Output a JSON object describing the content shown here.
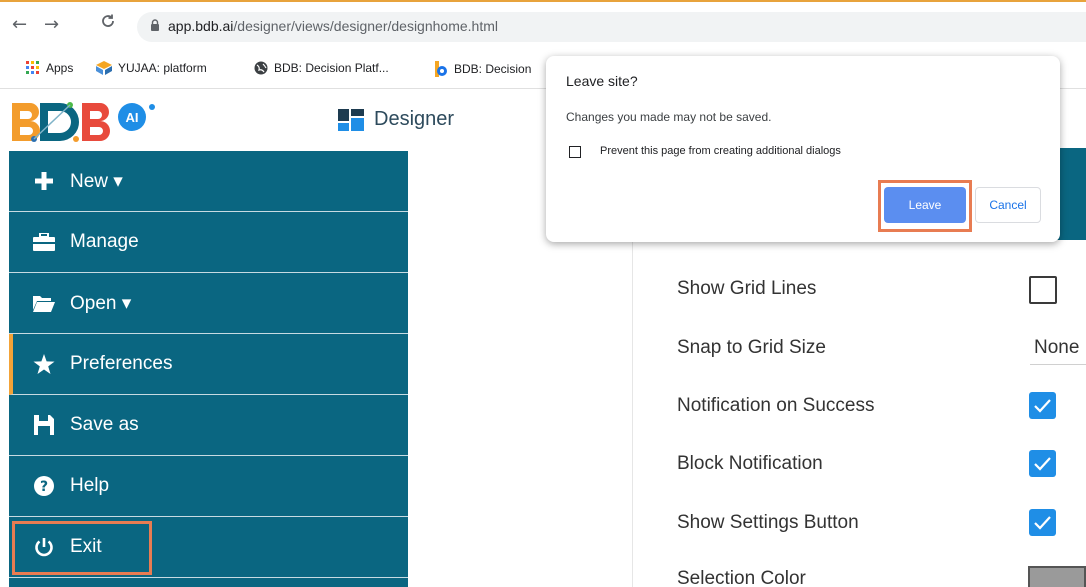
{
  "browser": {
    "back_icon": "arrow-left",
    "forward_icon": "arrow-right",
    "reload_icon": "reload",
    "url_host": "app.bdb.ai",
    "url_path": "/designer/views/designer/designhome.html",
    "bookmarks": [
      {
        "label": "Apps",
        "icon": "apps-grid"
      },
      {
        "label": "YUJAA: platform",
        "icon": "yujaa-logo"
      },
      {
        "label": "BDB: Decision Platf...",
        "icon": "globe"
      },
      {
        "label": "BDB: Decision",
        "icon": "bdb-logo"
      }
    ]
  },
  "app": {
    "title": "Designer",
    "logo_alt": "AI",
    "accent_color": "#0a6681",
    "active_color": "#f3a338"
  },
  "sidebar": {
    "items": [
      {
        "label": "New ▾",
        "icon": "plus"
      },
      {
        "label": "Manage",
        "icon": "briefcase"
      },
      {
        "label": "Open ▾",
        "icon": "folder-open"
      },
      {
        "label": "Preferences",
        "icon": "star",
        "active": true
      },
      {
        "label": "Save as",
        "icon": "save"
      },
      {
        "label": "Help",
        "icon": "question-circle"
      },
      {
        "label": "Exit",
        "icon": "power"
      }
    ]
  },
  "preferences": {
    "rows": [
      {
        "label": "Show Grid Lines",
        "checked": false
      },
      {
        "label": "Snap to Grid Size",
        "value": "None"
      },
      {
        "label": "Notification on Success",
        "checked": true
      },
      {
        "label": "Block Notification",
        "checked": true
      },
      {
        "label": "Show Settings Button",
        "checked": true
      },
      {
        "label": "Selection Color",
        "swatch": "#9a9a9a"
      }
    ]
  },
  "dialog": {
    "title": "Leave site?",
    "message": "Changes you made may not be saved.",
    "checkbox_label": "Prevent this page from creating additional dialogs",
    "leave_label": "Leave",
    "cancel_label": "Cancel"
  }
}
